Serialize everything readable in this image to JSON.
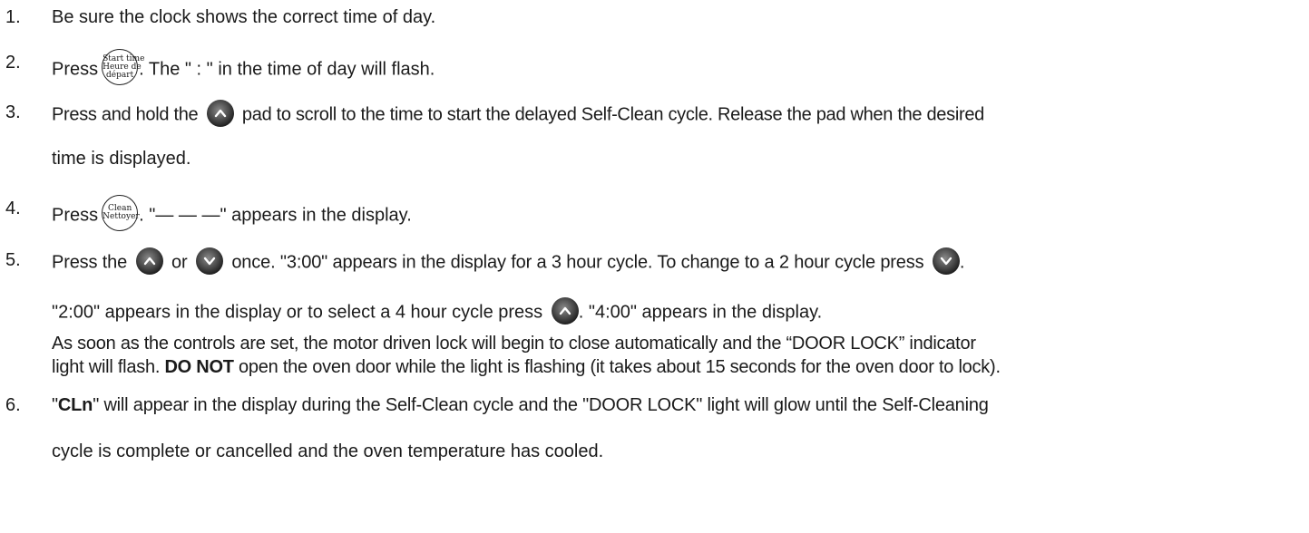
{
  "steps": [
    {
      "number": "1.",
      "text": "Be sure the clock shows the correct time of day."
    },
    {
      "number": "2.",
      "pre": "Press",
      "post": ". The \" : \" in the time of day will flash.",
      "icon": {
        "name": "start-time-pad",
        "lines": [
          "Start time",
          "Heure de",
          "départ"
        ]
      }
    },
    {
      "number": "3.",
      "pre": "Press and hold the",
      "post": "pad to scroll to the time to start the delayed Self-Clean cycle. Release the pad when the desired",
      "cont": "time is displayed."
    },
    {
      "number": "4.",
      "pre": "Press",
      "post": ". \"— — —\" appears in the display.",
      "icon": {
        "name": "clean-pad",
        "lines": [
          "Clean",
          "Nettoyer"
        ]
      }
    },
    {
      "number": "5.",
      "pre": "Press the",
      "mid": "or",
      "post": "once. \"3:00\" appears in the display for a 3 hour cycle. To change to a 2 hour cycle press",
      "end": ".",
      "cont_pre": "\"2:00\" appears in the display or to select a 4 hour cycle press",
      "cont_post": ". \"4:00\" appears in the display.",
      "para_line1": "As soon as the controls are set, the motor driven lock will begin to close automatically and the “DOOR LOCK” indicator",
      "para_line2_pre": "light will flash.",
      "para_bold": "DO NOT",
      "para_line2_post": "open the oven door while the light is flashing (it takes about 15 seconds for the oven door to lock)."
    },
    {
      "number": "6.",
      "quote_open": "\"",
      "bold": "CLn",
      "post": "\" will appear in the display during the Self-Clean cycle and the \"DOOR LOCK\" light will glow until the Self-Cleaning",
      "cont": "cycle is complete or cancelled and the oven temperature has cooled."
    }
  ],
  "icons": {
    "up": "up-arrow-pad-icon",
    "down": "down-arrow-pad-icon"
  }
}
